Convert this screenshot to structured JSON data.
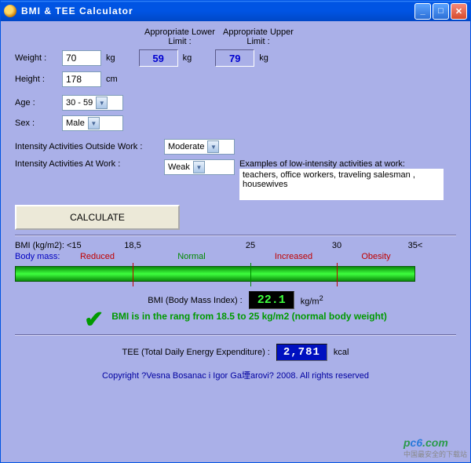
{
  "titlebar": {
    "title": "BMI & TEE Calculator"
  },
  "limits": {
    "lower_label": "Appropriate Lower Limit :",
    "upper_label": "Appropriate Upper Limit :",
    "lower_value": "59",
    "upper_value": "79",
    "unit": "kg"
  },
  "inputs": {
    "weight_label": "Weight :",
    "weight_value": "70",
    "weight_unit": "kg",
    "height_label": "Height :",
    "height_value": "178",
    "height_unit": "cm",
    "age_label": "Age :",
    "age_value": "30 - 59",
    "sex_label": "Sex :",
    "sex_value": "Male",
    "outside_label": "Intensity Activities Outside Work :",
    "outside_value": "Moderate",
    "atwork_label": "Intensity Activities At Work :",
    "atwork_value": "Weak",
    "examples_label": "Examples of low-intensity activities at work:",
    "examples_text": "teachers, office workers, traveling salesman , housewives"
  },
  "actions": {
    "calculate": "CALCULATE"
  },
  "scale": {
    "header": "BMI (kg/m2): <15",
    "ticks": {
      "t185": "18,5",
      "t25": "25",
      "t30": "30",
      "t35": "35<"
    },
    "cats": {
      "bodymass": "Body mass:",
      "reduced": "Reduced",
      "normal": "Normal",
      "increased": "Increased",
      "obesity": "Obesity"
    }
  },
  "bmi": {
    "label": "BMI (Body Mass Index) :",
    "value": "22.1",
    "unit": "kg/m",
    "unit_sup": "2",
    "status": "BMI is in the rang from 18.5 to 25 kg/m2 (normal body weight)"
  },
  "tee": {
    "label": "TEE (Total Daily Energy Expenditure) :",
    "value": "2,781",
    "unit": "kcal"
  },
  "footer": {
    "copyright": "Copyright ?Vesna Bosanac i Igor Ga堙arovi? 2008. All rights reserved",
    "watermark_p": "p",
    "watermark_c6": "c6",
    "watermark_com": ".com",
    "watermark_sub": "中国最安全的下载站"
  }
}
